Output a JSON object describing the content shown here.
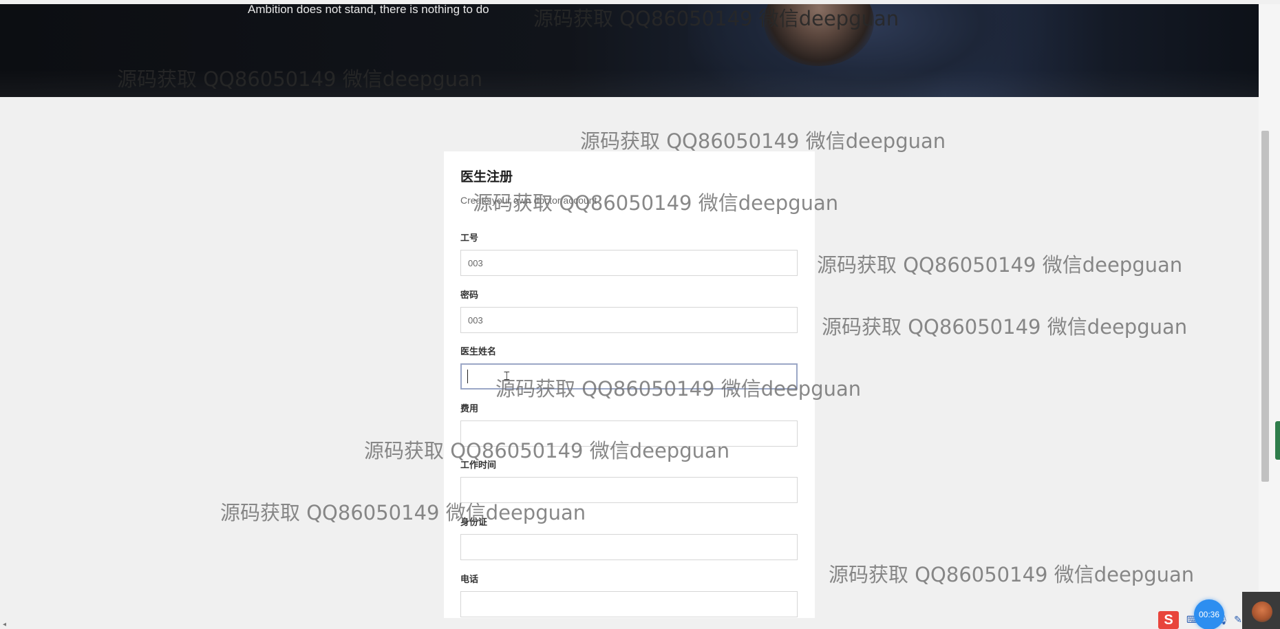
{
  "hero": {
    "tagline": "Ambition does not stand, there is nothing to do"
  },
  "form": {
    "title": "医生注册",
    "subtitle": "Create your own doctor account",
    "fields": [
      {
        "label": "工号",
        "value": "003"
      },
      {
        "label": "密码",
        "value": "003"
      },
      {
        "label": "医生姓名",
        "value": ""
      },
      {
        "label": "费用",
        "value": ""
      },
      {
        "label": "工作时间",
        "value": ""
      },
      {
        "label": "身份证",
        "value": ""
      },
      {
        "label": "电话",
        "value": ""
      }
    ]
  },
  "watermark": "源码获取 QQ86050149 微信deepguan",
  "overlay": {
    "timer": "00:36",
    "ime_logo": "S"
  },
  "icons": {
    "cursor": "text-cursor-icon",
    "tray": [
      "keyboard-icon",
      "emoji-icon",
      "mic-icon",
      "pen-icon",
      "grid-icon"
    ]
  },
  "colors": {
    "background": "#f0f0f0",
    "card": "#ffffff",
    "focus_border": "#9aa6c6",
    "timer": "#2d8ef0",
    "ime": "#e8453c"
  }
}
